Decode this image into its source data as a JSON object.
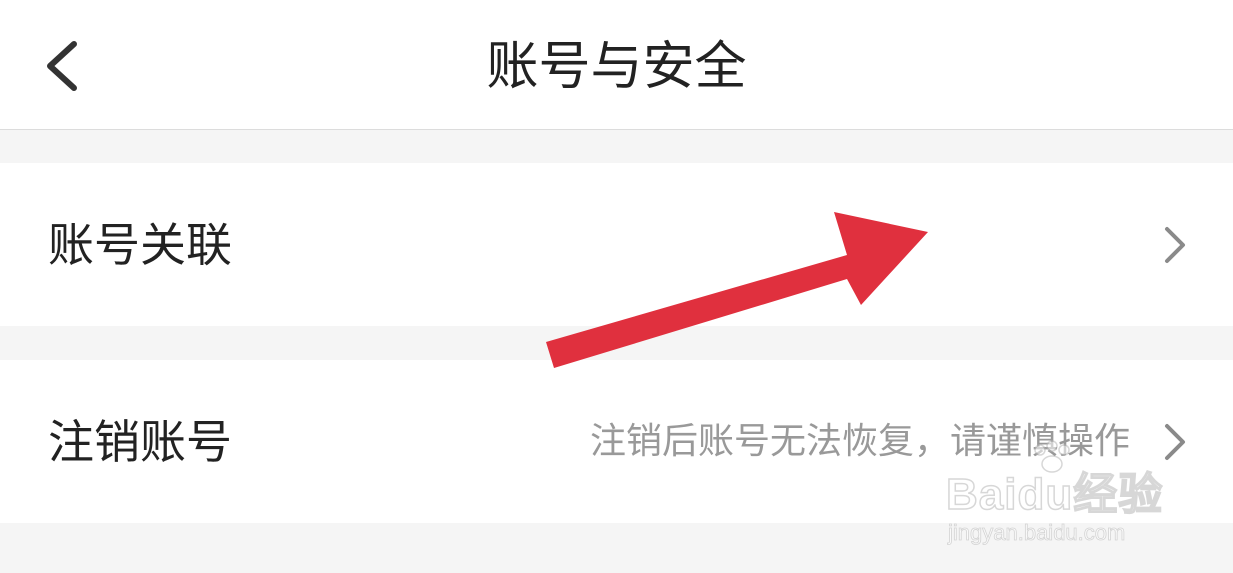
{
  "header": {
    "title": "账号与安全",
    "back_icon": "chevron-left-icon"
  },
  "rows": [
    {
      "label": "账号关联",
      "hint": "",
      "icon": "chevron-right-icon"
    },
    {
      "label": "注销账号",
      "hint": "注销后账号无法恢复，请谨慎操作",
      "icon": "chevron-right-icon"
    }
  ],
  "annotation": {
    "icon": "red-arrow-icon",
    "color": "#e0303e"
  },
  "watermark": {
    "brand": "Baidu经验",
    "url": "jingyan.baidu.com"
  },
  "colors": {
    "background": "#f5f5f5",
    "surface": "#ffffff",
    "text": "#222222",
    "hint_text": "#999999",
    "chevron": "#8a8a8a"
  }
}
